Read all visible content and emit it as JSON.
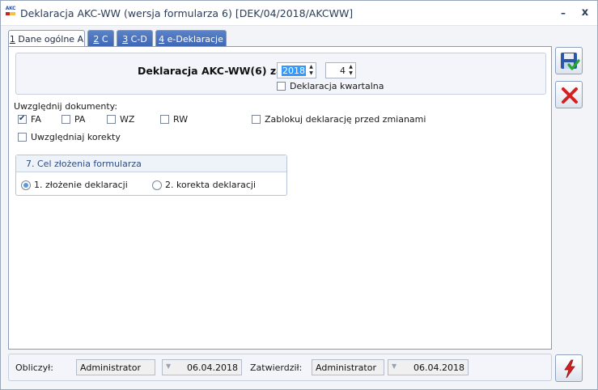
{
  "window": {
    "icon_text": "AKC",
    "title": "Deklaracja AKC-WW (wersja formularza 6) [DEK/04/2018/AKCWW]",
    "minimize_glyph": "–",
    "close_glyph": "x"
  },
  "tabs": [
    {
      "key": "1",
      "label": " Dane ogólne A",
      "active": true
    },
    {
      "key": "2",
      "label": " C",
      "active": false
    },
    {
      "key": "3",
      "label": " C-D",
      "active": false
    },
    {
      "key": "4",
      "label": " e-Deklaracje",
      "active": false
    }
  ],
  "declaration": {
    "label": "Deklaracja AKC-WW(6) za:",
    "year": "2018",
    "month": "4",
    "quarterly_label": "Deklaracja kwartalna",
    "quarterly_checked": false
  },
  "documents": {
    "label": "Uwzględnij dokumenty:",
    "fa": {
      "label": "FA",
      "checked": true
    },
    "pa": {
      "label": "PA",
      "checked": false
    },
    "wz": {
      "label": "WZ",
      "checked": false
    },
    "rw": {
      "label": "RW",
      "checked": false
    },
    "lock": {
      "label": "Zablokuj deklarację przed zmianami",
      "checked": false
    },
    "corrections": {
      "label": "Uwzględniaj korekty",
      "checked": false
    }
  },
  "purpose": {
    "title": "7. Cel złożenia formularza",
    "option1": "1. złożenie deklaracji",
    "option2": "2. korekta deklaracji",
    "selected": 1
  },
  "footer": {
    "calculated_label": "Obliczył:",
    "calculated_by": "Administrator",
    "calculated_date": "06.04.2018",
    "approved_label": "Zatwierdził:",
    "approved_by": "Administrator",
    "approved_date": "06.04.2018"
  },
  "colors": {
    "tab_active": "#ffffff",
    "tab_inactive": "#4a72bd",
    "cancel_red": "#d42020",
    "save_blue": "#2c56a7"
  },
  "icons": {
    "save": "save-disk-check-icon",
    "cancel": "red-x-icon",
    "action": "lightning-icon"
  }
}
